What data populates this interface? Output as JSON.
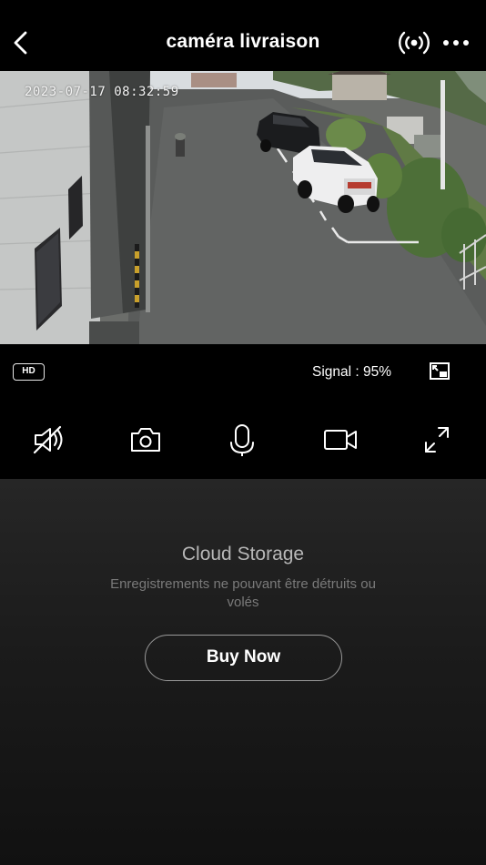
{
  "header": {
    "title": "caméra livraison",
    "back_icon": "chevron-left-icon",
    "signal_icon": "wireless-signal-icon",
    "more_icon": "more-dots-icon"
  },
  "video": {
    "timestamp": "2023-07-17 08:32:59"
  },
  "infobar": {
    "quality": "HD",
    "signal": "Signal : 95%",
    "pip_icon": "picture-in-picture-icon"
  },
  "controls": [
    {
      "name": "mute",
      "icon": "speaker-muted-icon"
    },
    {
      "name": "snapshot",
      "icon": "camera-icon"
    },
    {
      "name": "talk",
      "icon": "microphone-icon"
    },
    {
      "name": "record",
      "icon": "video-record-icon"
    },
    {
      "name": "fullscreen",
      "icon": "expand-icon"
    }
  ],
  "cloud": {
    "title": "Cloud Storage",
    "description": "Enregistrements ne pouvant être détruits ou volés",
    "button": "Buy Now"
  },
  "colors": {
    "background": "#000000",
    "panel": "#1c1c1c",
    "muted_text": "#7a7a7a"
  }
}
